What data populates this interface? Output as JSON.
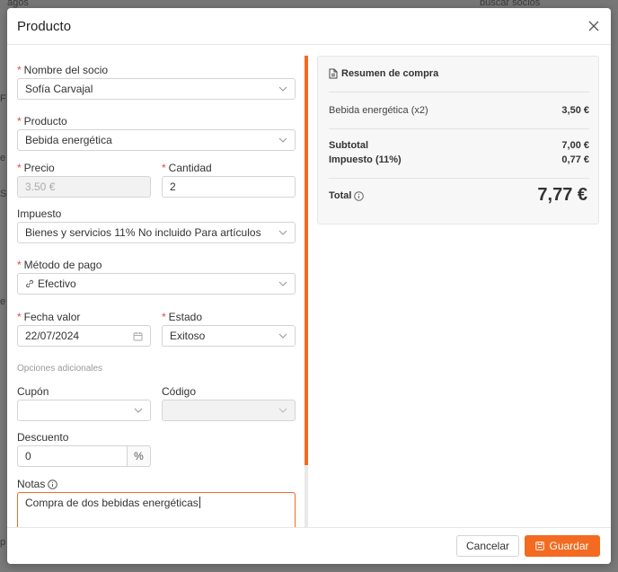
{
  "background": {
    "fragment_top": "agos",
    "search_fragment": "buscar socios",
    "side_letters": [
      "F",
      "e",
      "S",
      "e",
      "p"
    ]
  },
  "modal": {
    "title": "Producto"
  },
  "form": {
    "socio_label": "Nombre del socio",
    "socio_value": "Sofía Carvajal",
    "producto_label": "Producto",
    "producto_value": "Bebida energética",
    "precio_label": "Precio",
    "precio_value": "3.50 €",
    "cantidad_label": "Cantidad",
    "cantidad_value": "2",
    "impuesto_label": "Impuesto",
    "impuesto_value": "Bienes y servicios 11% No incluido Para artículos",
    "metodo_label": "Método de pago",
    "metodo_value": "Efectivo",
    "fecha_label": "Fecha valor",
    "fecha_value": "22/07/2024",
    "estado_label": "Estado",
    "estado_value": "Exitoso",
    "opciones_title": "Opciones adicionales",
    "cupon_label": "Cupón",
    "cupon_value": "",
    "codigo_label": "Código",
    "codigo_value": "",
    "descuento_label": "Descuento",
    "descuento_value": "0",
    "descuento_unit": "%",
    "notas_label": "Notas",
    "notas_value": "Compra de dos bebidas energéticas",
    "required_mark": "*"
  },
  "summary": {
    "title": "Resumen de compra",
    "item_label": "Bebida energética (x2)",
    "item_value": "3,50 €",
    "subtotal_label": "Subtotal",
    "subtotal_value": "7,00 €",
    "impuesto_label": "Impuesto (11%)",
    "impuesto_value": "0,77 €",
    "total_label": "Total",
    "total_value": "7,77 €"
  },
  "footer": {
    "cancel_label": "Cancelar",
    "save_label": "Guardar"
  },
  "colors": {
    "accent": "#f26b21",
    "required": "#e64545"
  }
}
